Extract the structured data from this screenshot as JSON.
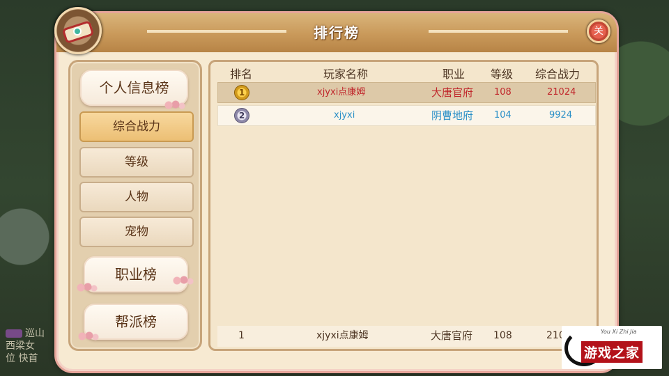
{
  "window": {
    "title": "排行榜",
    "close_label": "关"
  },
  "left_panel": {
    "categories": [
      "个人信息榜",
      "职业榜",
      "帮派榜"
    ],
    "sub_tabs": [
      "综合战力",
      "等级",
      "人物",
      "宠物"
    ],
    "active_sub_tab": "综合战力"
  },
  "table": {
    "headers": [
      "排名",
      "玩家名称",
      "职业",
      "等级",
      "综合战力"
    ],
    "rows": [
      {
        "rank": "1",
        "name": "xjyxi点康姆",
        "job": "大唐官府",
        "level": "108",
        "power": "21024",
        "color": "#c0262b"
      },
      {
        "rank": "2",
        "name": "xjyxi",
        "job": "阴曹地府",
        "level": "104",
        "power": "9924",
        "color": "#2a8fc7"
      }
    ],
    "my_rank": {
      "rank": "1",
      "name": "xjyxi点康姆",
      "job": "大唐官府",
      "level": "108",
      "power": "210"
    }
  },
  "background_text": {
    "lines": [
      "巡山",
      "西梁女",
      "位 快首"
    ]
  },
  "watermark": {
    "brand": "游戏之家",
    "small": "You Xi Zhi Jia"
  }
}
